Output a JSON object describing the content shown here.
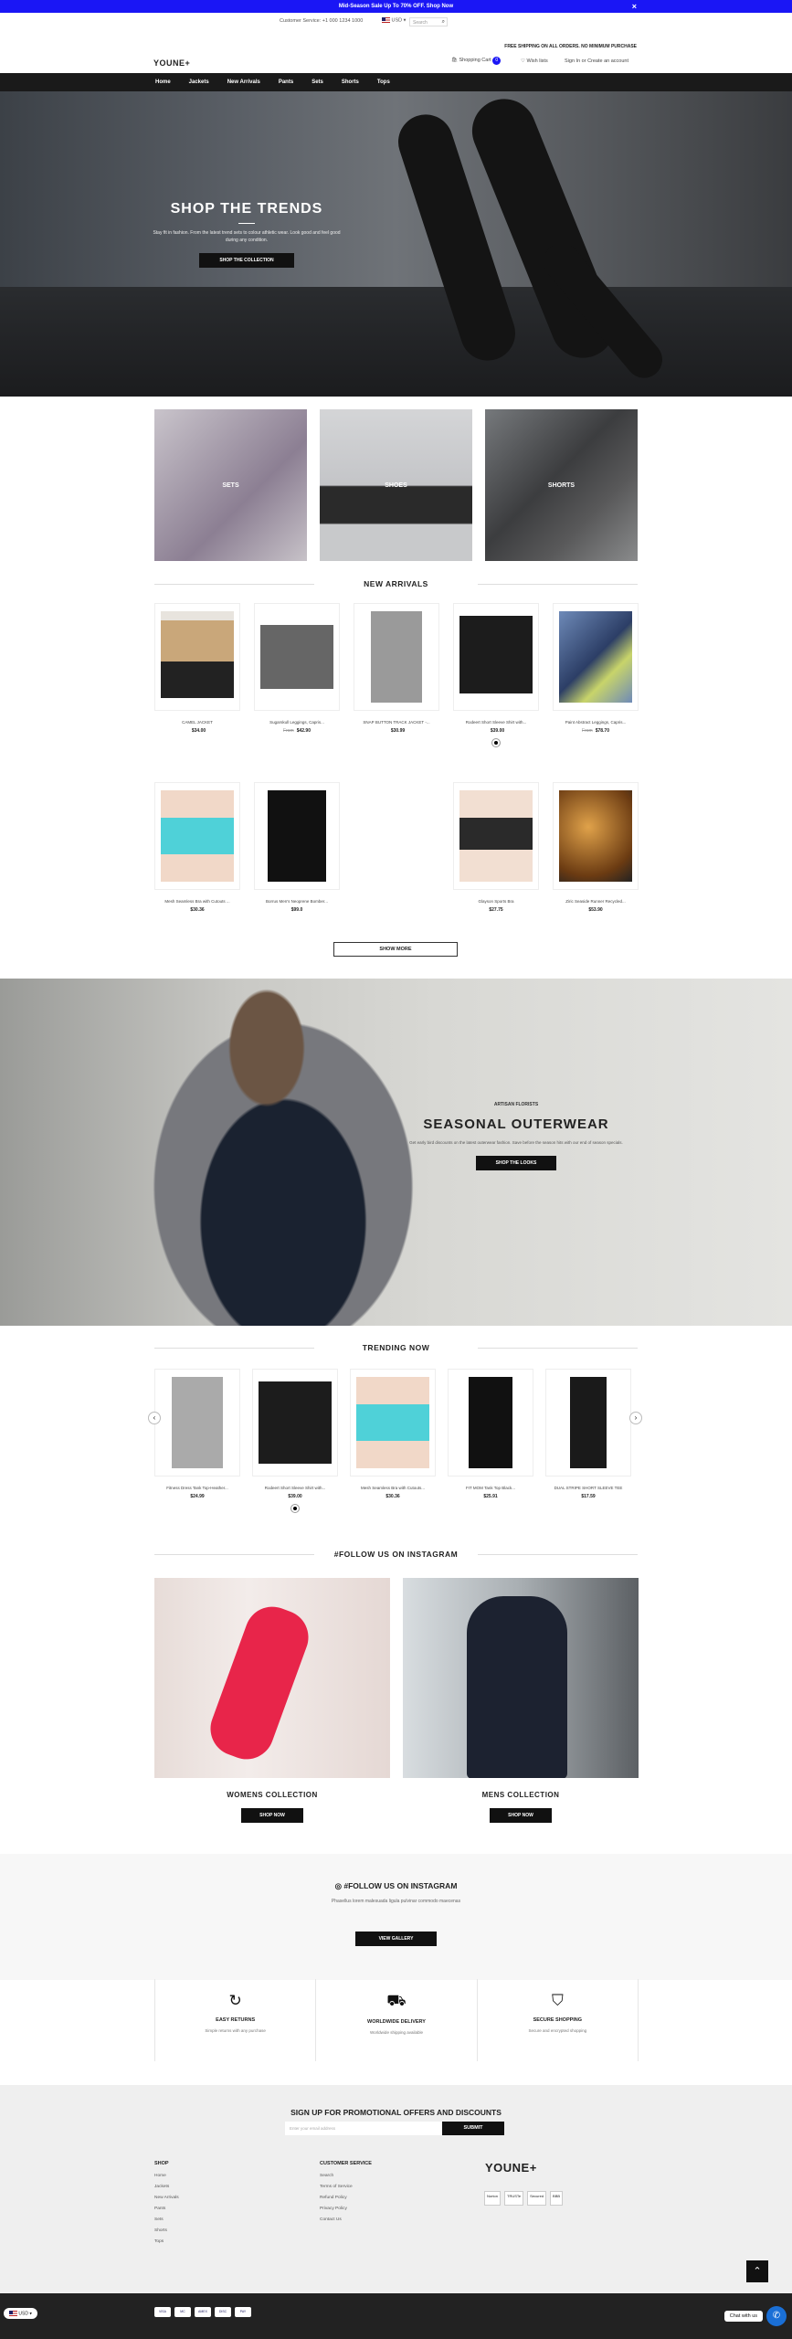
{
  "promo": {
    "text": "Mid-Season Sale Up To 70% OFF. Shop Now",
    "close": "×"
  },
  "topbar": {
    "service": "Customer Service: +1 000 1234 1000",
    "currency": "USD",
    "search_placeholder": "Search",
    "free_shipping": "FREE SHIPPING ON ALL ORDERS. NO MINIMUM PURCHASE"
  },
  "header": {
    "logo": "YOUNE+",
    "cart_label": "Shopping Cart",
    "cart_count": "0",
    "wishlist": "Wish lists",
    "account": "Sign In or Create an account"
  },
  "nav": [
    "Home",
    "Jackets",
    "New Arrivals",
    "Pants",
    "Sets",
    "Shorts",
    "Tops"
  ],
  "hero": {
    "title": "SHOP THE TRENDS",
    "text": "Stay fit in fashion. From the latest trend sets to colour athletic wear. Look good and feel good during any condition.",
    "button": "SHOP THE COLLECTION"
  },
  "categories": [
    {
      "label": "SETS"
    },
    {
      "label": "SHOES"
    },
    {
      "label": "SHORTS"
    }
  ],
  "new_arrivals": {
    "title": "NEW ARRIVALS",
    "row1": [
      {
        "name": "CAMEL JACKET",
        "price": "$34.00",
        "old": ""
      },
      {
        "name": "Sugarskull Leggings, Capris...",
        "price": "$42.90",
        "old": "From"
      },
      {
        "name": "SNAP BUTTON TRACK JACKET -...",
        "price": "$30.99",
        "old": ""
      },
      {
        "name": "Rodeert Short Sleeve Shirt with...",
        "price": "$39.00",
        "old": ""
      },
      {
        "name": "Paint Abstract Leggings, Capris...",
        "price": "$78.70",
        "old": "From"
      }
    ],
    "row2": [
      {
        "name": "Mesh Seamless Bra with Cutouts ...",
        "price": "$30.36"
      },
      {
        "name": "Borrus Men's Neoprene Bomber...",
        "price": "$99.0"
      },
      {
        "name": "Glayson Sports Bra",
        "price": "$27.75"
      },
      {
        "name": "Ziric Seaside Runner Recycled...",
        "price": "$53.90"
      }
    ],
    "show_more": "SHOW MORE"
  },
  "outerwear": {
    "sub": "ARTISAN FLORISTS",
    "title": "SEASONAL OUTERWEAR",
    "text": "Get early bird discounts on the latest outerwear fashion. Save before the season hits with our end of season specials.",
    "button": "SHOP THE LOOKS"
  },
  "trending": {
    "title": "TRENDING NOW",
    "items": [
      {
        "name": "Fitness Dress Tank Top-Heather...",
        "price": "$24.99"
      },
      {
        "name": "Rodeert Short Sleeve Shirt with...",
        "price": "$39.00"
      },
      {
        "name": "Mesh Seamless Bra with Cutouts...",
        "price": "$30.36"
      },
      {
        "name": "FIT MOM Tank Top Black...",
        "price": "$25.91"
      },
      {
        "name": "DUAL STRIPE SHORT SLEEVE TEE",
        "price": "$17.59"
      }
    ]
  },
  "instagram": {
    "title": "#FOLLOW US ON INSTAGRAM",
    "womens": "WOMENS COLLECTION",
    "mens": "MENS COLLECTION",
    "shop_now": "SHOP NOW"
  },
  "follow": {
    "title": "#FOLLOW US ON INSTAGRAM",
    "text": "Phasellus lorem malesuada ligula pulvinar commodo maecenas",
    "button": "VIEW GALLERY"
  },
  "features": [
    {
      "icon": "↻",
      "title": "EASY RETURNS",
      "desc": "Simple returns with any purchase"
    },
    {
      "icon": "⛟",
      "title": "WORLDWIDE DELIVERY",
      "desc": "Worldwide shipping available"
    },
    {
      "icon": "⛉",
      "title": "SECURE SHOPPING",
      "desc": "Secure and encrypted shopping"
    }
  ],
  "newsletter": {
    "title": "SIGN UP FOR PROMOTIONAL OFFERS AND DISCOUNTS",
    "placeholder": "Enter your email address",
    "submit": "SUBMIT"
  },
  "footer": {
    "shop_title": "SHOP",
    "shop": [
      "Home",
      "Jackets",
      "New Arrivals",
      "Pants",
      "Sets",
      "Shorts",
      "Tops"
    ],
    "cs_title": "CUSTOMER SERVICE",
    "cs": [
      "Search",
      "Terms of Service",
      "Refund Policy",
      "Privacy Policy",
      "Contact Us"
    ],
    "logo": "YOUNE+",
    "badges": [
      "Norton",
      "TRUSTe",
      "Secured",
      "BBB"
    ]
  },
  "bottom": {
    "payments": [
      "VISA",
      "MC",
      "AMEX",
      "DISC",
      "PAY"
    ],
    "currency": "USD",
    "chat": "Chat with us"
  },
  "colors": {
    "accent": "#1a16f5",
    "dark": "#111111"
  }
}
